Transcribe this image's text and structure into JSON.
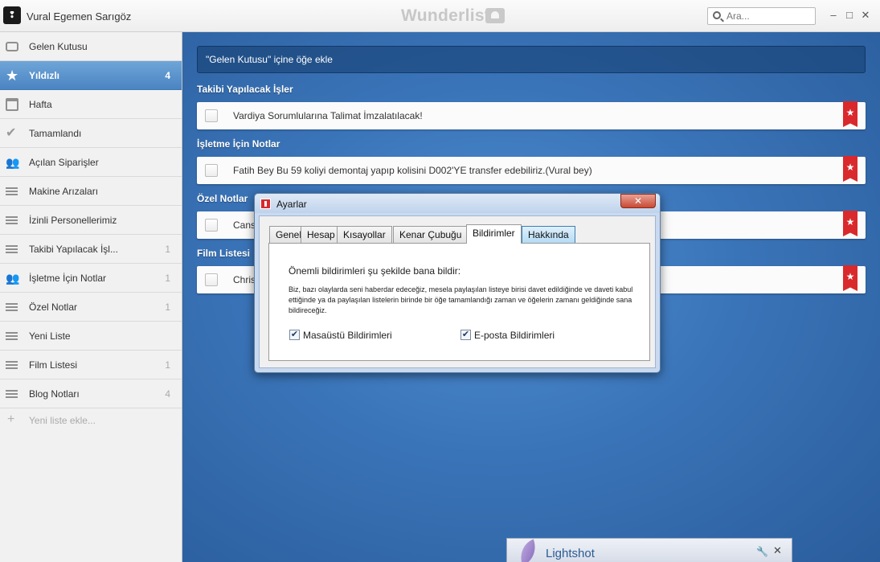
{
  "titlebar": {
    "avatar_glyph": "❢",
    "username": "Vural Egemen Sarıgöz",
    "brand": "Wunderlist",
    "search_placeholder": "Ara...",
    "minimize": "–",
    "maximize": "□",
    "close": "✕"
  },
  "sidebar": {
    "items": [
      {
        "label": "Gelen Kutusu",
        "count": "",
        "icon": "inbox-icon"
      },
      {
        "label": "Yıldızlı",
        "count": "4",
        "icon": "star-icon"
      },
      {
        "label": "Hafta",
        "count": "",
        "icon": "calendar-icon"
      },
      {
        "label": "Tamamlandı",
        "count": "",
        "icon": "check-icon"
      },
      {
        "label": "Açılan Siparişler",
        "count": "",
        "icon": "users-icon"
      },
      {
        "label": "Makine Arızaları",
        "count": "",
        "icon": "list-icon"
      },
      {
        "label": "İzinli Personellerimiz",
        "count": "",
        "icon": "list-icon"
      },
      {
        "label": "Takibi Yapılacak İşl...",
        "count": "1",
        "icon": "list-icon"
      },
      {
        "label": "İşletme İçin Notlar",
        "count": "1",
        "icon": "users-icon"
      },
      {
        "label": "Özel Notlar",
        "count": "1",
        "icon": "list-icon"
      },
      {
        "label": "Yeni Liste",
        "count": "",
        "icon": "list-icon"
      },
      {
        "label": "Film Listesi",
        "count": "1",
        "icon": "list-icon"
      },
      {
        "label": "Blog Notları",
        "count": "4",
        "icon": "list-icon"
      }
    ],
    "add_list_label": "Yeni liste ekle...",
    "add_list_glyph": "+"
  },
  "main": {
    "add_placeholder": "\"Gelen Kutusu\" içine öğe ekle",
    "sections": [
      {
        "title": "Takibi Yapılacak İşler",
        "task": "Vardiya Sorumlularına Talimat İmzalatılacak!"
      },
      {
        "title": "İşletme İçin Notlar",
        "task": "Fatih Bey Bu 59 koliyi demontaj yapıp kolisini D002'YE transfer edebiliriz.(Vural bey)"
      },
      {
        "title": "Özel Notlar",
        "task": "Cans"
      },
      {
        "title": "Film Listesi",
        "task": "Chris"
      }
    ],
    "star_glyph": "★"
  },
  "dialog": {
    "title": "Ayarlar",
    "close_glyph": "✕",
    "tabs": [
      "Genel",
      "Hesap",
      "Kısayollar",
      "Kenar Çubuğu",
      "Bildirimler",
      "Hakkında"
    ],
    "selected_tab": "Bildirimler",
    "heading": "Önemli bildirimleri şu şekilde bana bildir:",
    "description": "Biz, bazı olaylarda seni haberdar edeceğiz, mesela paylaşılan listeye birisi davet edildiğinde ve daveti kabul ettiğinde ya da paylaşılan listelerin birinde bir öğe tamamlandığı zaman ve öğelerin zamanı geldiğinde sana bildireceğiz.",
    "desktop_label": "Masaüstü Bildirimleri",
    "desktop_checked": true,
    "email_label": "E-posta Bildirimleri",
    "email_checked": true,
    "check_glyph": "✔"
  },
  "lightshot": {
    "title": "Lightshot",
    "wrench_glyph": "🔧",
    "close_glyph": "✕"
  },
  "colors": {
    "accent_blue": "#4a84c2",
    "star_red": "#d9292c",
    "background_blue": "#3a74b8"
  }
}
